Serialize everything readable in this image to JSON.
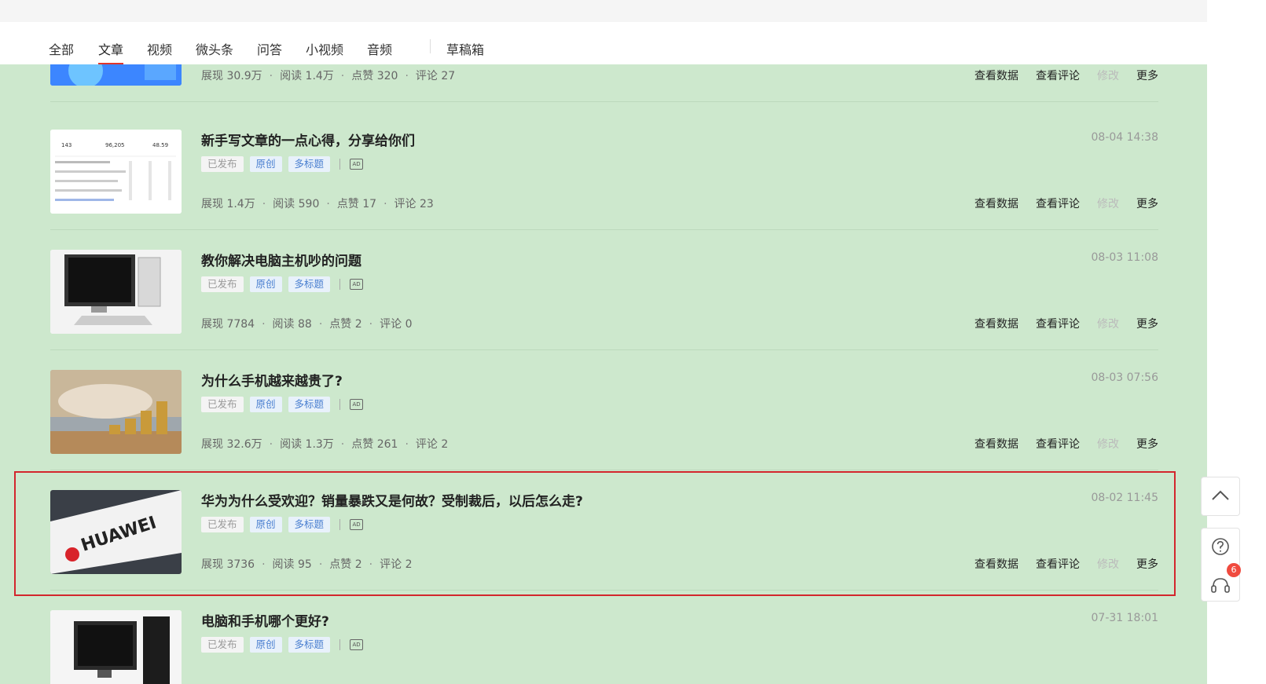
{
  "tabs": [
    {
      "label": "全部"
    },
    {
      "label": "文章",
      "active": true
    },
    {
      "label": "视频"
    },
    {
      "label": "微头条"
    },
    {
      "label": "问答"
    },
    {
      "label": "小视频"
    },
    {
      "label": "音频"
    },
    {
      "label": "草稿箱"
    }
  ],
  "labels": {
    "impressions": "展现",
    "reads": "阅读",
    "likes": "点赞",
    "comments": "评论",
    "view_data": "查看数据",
    "view_comments": "查看评论",
    "edit": "修改",
    "more": "更多"
  },
  "tags": {
    "published": "已发布",
    "original": "原创",
    "multi_title": "多标题",
    "ad_icon": "AD"
  },
  "articles": [
    {
      "title": "",
      "date": "",
      "impressions": "30.9万",
      "reads": "1.4万",
      "likes": "320",
      "comments": "27"
    },
    {
      "title": "新手写文章的一点心得，分享给你们",
      "date": "08-04 14:38",
      "impressions": "1.4万",
      "reads": "590",
      "likes": "17",
      "comments": "23"
    },
    {
      "title": "教你解决电脑主机吵的问题",
      "date": "08-03 11:08",
      "impressions": "7784",
      "reads": "88",
      "likes": "2",
      "comments": "0"
    },
    {
      "title": "为什么手机越来越贵了?",
      "date": "08-03 07:56",
      "impressions": "32.6万",
      "reads": "1.3万",
      "likes": "261",
      "comments": "2"
    },
    {
      "title": "华为为什么受欢迎？销量暴跌又是何故？受制裁后，以后怎么走?",
      "date": "08-02 11:45",
      "impressions": "3736",
      "reads": "95",
      "likes": "2",
      "comments": "2",
      "thumb_text": "HUAWEI"
    },
    {
      "title": "电脑和手机哪个更好?",
      "date": "07-31 18:01",
      "impressions": "",
      "reads": "",
      "likes": "",
      "comments": ""
    }
  ],
  "thumb_stats": {
    "v1": "143",
    "v2": "96,205",
    "v3": "48.59"
  },
  "sidebar": {
    "badge_count": "6"
  },
  "colors": {
    "content_bg": "#cde8cd",
    "accent": "#e0352b",
    "highlight": "#d3262d",
    "tag_blue": "#4a7fd0"
  }
}
